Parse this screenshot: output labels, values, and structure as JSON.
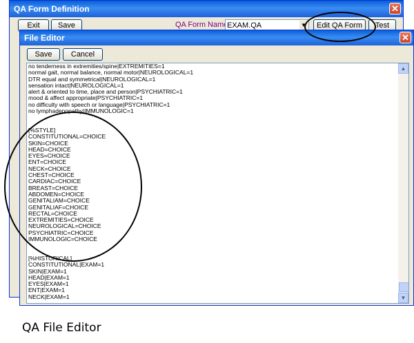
{
  "outer_window": {
    "title": "QA Form Definition",
    "exit_label": "Exit",
    "save_label": "Save",
    "form_name_label": "QA Form Name",
    "form_name_value": "EXAM.QA",
    "edit_form_label": "Edit QA Form",
    "test_label": "Test"
  },
  "editor_window": {
    "title": "File Editor",
    "save_label": "Save",
    "cancel_label": "Cancel",
    "lines": [
      "no tenderness in extremities/spine|EXTREMITIES=1",
      "normal gait, normal balance, normal motor|NEUROLOGICAL=1",
      "DTR equal and symmetrical|NEUROLOGICAL=1",
      "sensation intact|NEUROLOGICAL=1",
      "alert & oriented to time, place and person|PSYCHIATRIC=1",
      "mood & affect appropriate|PSYCHIATRIC=1",
      "no difficulty with speech or language|PSYCHIATRIC=1",
      "no lymphadenopathy|IMMUNOLOGIC=1",
      "",
      "",
      "[%STYLE]",
      "CONSTITUTIONAL=CHOICE",
      "SKIN=CHOICE",
      "HEAD=CHOICE",
      "EYES=CHOICE",
      "ENT=CHOICE",
      "NECK=CHOICE",
      "CHEST=CHOICE",
      "CARDIAC=CHOICE",
      "BREAST=CHOICE",
      "ABDOMEN=CHOICE",
      "GENITALIAM=CHOICE",
      "GENITALIAF=CHOICE",
      "RECTAL=CHOICE",
      "EXTREMITIES=CHOICE",
      "NEUROLOGICAL=CHOICE",
      "PSYCHIATRIC=CHOICE",
      "IMMUNOLOGIC=CHOICE",
      "",
      "",
      "[%HISTORICAL]",
      "CONSTITUTIONAL|EXAM=1",
      "SKIN|EXAM=1",
      "HEAD|EXAM=1",
      "EYES|EXAM=1",
      "ENT|EXAM=1",
      "NECK|EXAM=1"
    ]
  },
  "caption": "QA File Editor",
  "icons": {
    "close": "close-icon",
    "dropdown": "chevron-down-icon",
    "scroll_up": "chevron-up-icon",
    "scroll_down": "chevron-down-icon"
  },
  "colors": {
    "title_bar": "#1e62d8",
    "window_bg": "#ece9d8",
    "form_label": "#800080",
    "close_button": "#c8432a"
  }
}
